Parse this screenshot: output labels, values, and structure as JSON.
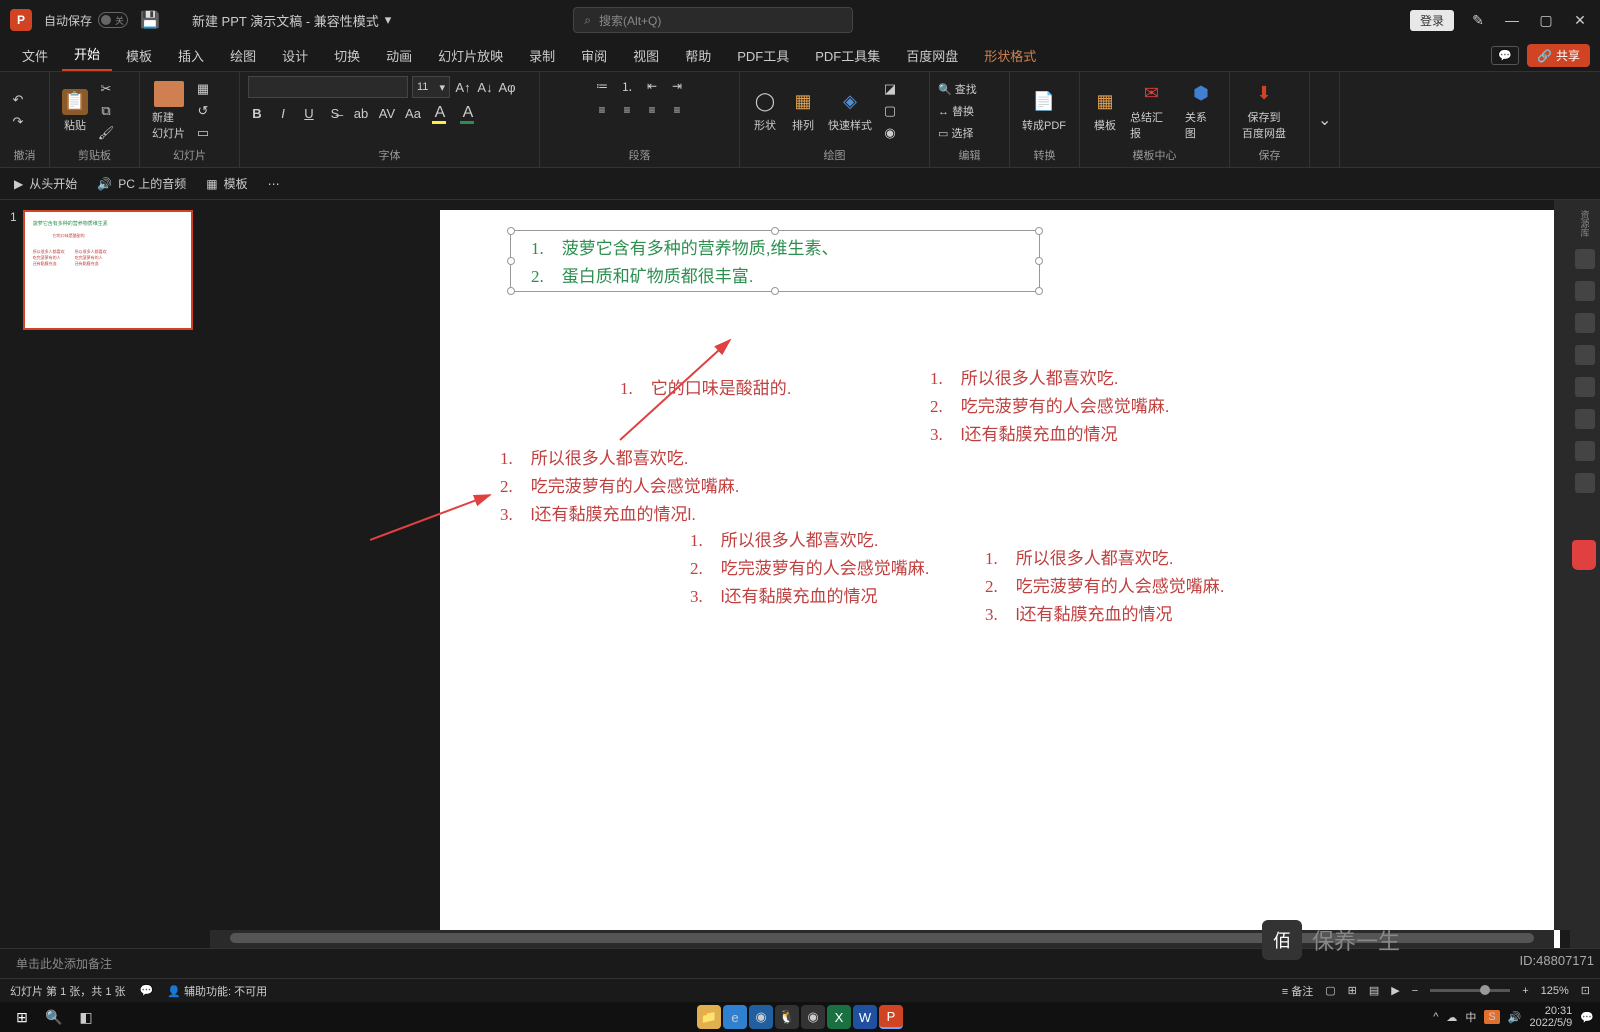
{
  "titlebar": {
    "autosave_label": "自动保存",
    "autosave_state": "关",
    "doc_title": "新建 PPT 演示文稿 - 兼容性模式",
    "search_placeholder": "搜索(Alt+Q)",
    "login": "登录"
  },
  "tabs": [
    "文件",
    "开始",
    "模板",
    "插入",
    "绘图",
    "设计",
    "切换",
    "动画",
    "幻灯片放映",
    "录制",
    "审阅",
    "视图",
    "帮助",
    "PDF工具",
    "PDF工具集",
    "百度网盘",
    "形状格式"
  ],
  "active_tab": 1,
  "contextual_tab": 16,
  "share_label": "共享",
  "ribbon": {
    "undo_label": "撤消",
    "clipboard_label": "剪贴板",
    "paste_label": "粘贴",
    "slides_label": "幻灯片",
    "new_slide_label": "新建\n幻灯片",
    "font_label": "字体",
    "font_size": "11",
    "paragraph_label": "段落",
    "drawing_label": "绘图",
    "shape_label": "形状",
    "arrange_label": "排列",
    "quick_style_label": "快速样式",
    "editing_label": "编辑",
    "find_label": "查找",
    "replace_label": "替换",
    "select_label": "选择",
    "convert_label": "转换",
    "convert_pdf_label": "转成PDF",
    "template_center_label": "模板中心",
    "template_label": "模板",
    "summary_label": "总结汇报",
    "relation_label": "关系图",
    "save_label": "保存",
    "save_to_label": "保存到\n百度网盘"
  },
  "quickbar": {
    "from_start": "从头开始",
    "pc_audio": "PC 上的音频",
    "template": "模板"
  },
  "thumb": {
    "num": "1"
  },
  "slide": {
    "green_list": [
      "菠萝它含有多种的营养物质,维生素、",
      "蛋白质和矿物质都很丰富."
    ],
    "red_center": "它的口味是酸甜的.",
    "red_list_a": [
      "所以很多人都喜欢吃.",
      "吃完菠萝有的人会感觉嘴麻.",
      "l还有黏膜充血的情况l."
    ],
    "red_list_b": [
      "所以很多人都喜欢吃.",
      "吃完菠萝有的人会感觉嘴麻.",
      "l还有黏膜充血的情况"
    ],
    "red_list_c": [
      "所以很多人都喜欢吃.",
      "吃完菠萝有的人会感觉嘴麻.",
      "l还有黏膜充血的情况"
    ],
    "red_list_d": [
      "所以很多人都喜欢吃.",
      "吃完菠萝有的人会感觉嘴麻.",
      "l还有黏膜充血的情况"
    ]
  },
  "notes_placeholder": "单击此处添加备注",
  "status": {
    "slide_info": "幻灯片 第 1 张，共 1 张",
    "accessibility": "辅助功能: 不可用",
    "notes_btn": "备注",
    "zoom": "125%"
  },
  "taskbar": {
    "time": "20:31",
    "date": "2022/5/9",
    "ime": "中"
  },
  "watermark": {
    "text": "保养一生",
    "id": "ID:48807171"
  },
  "colors": {
    "green": "#2d8f4f",
    "red": "#c04040",
    "accent": "#d04424"
  }
}
